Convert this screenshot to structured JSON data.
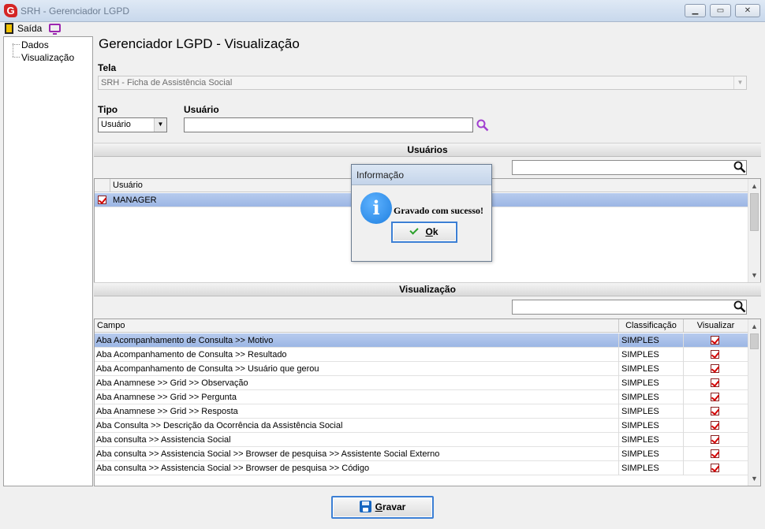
{
  "window": {
    "logo_letter": "G",
    "title": "SRH - Gerenciador LGPD",
    "min_glyph": "▁",
    "max_glyph": "▭",
    "close_glyph": "✕"
  },
  "toolbar": {
    "exit_label": "Saída"
  },
  "tree": {
    "items": [
      "Dados",
      "Visualização"
    ]
  },
  "page_title": "Gerenciador LGPD - Visualização",
  "form": {
    "tela_label": "Tela",
    "tela_value": "SRH - Ficha de Assistência Social",
    "tipo_label": "Tipo",
    "tipo_value": "Usuário",
    "usuario_label": "Usuário",
    "usuario_value": "",
    "dropdown_glyph": "▼"
  },
  "usuarios_section": {
    "title": "Usuários",
    "filter_value": "",
    "column_header": "Usuário",
    "rows": [
      {
        "name": "MANAGER",
        "checked": true,
        "selected": true
      }
    ]
  },
  "visualizacao_section": {
    "title": "Visualização",
    "filter_value": "",
    "headers": {
      "campo": "Campo",
      "classificacao": "Classificação",
      "visualizar": "Visualizar"
    },
    "rows": [
      {
        "campo": "Aba Acompanhamento de Consulta >> Motivo",
        "classificacao": "SIMPLES",
        "visualizar": true
      },
      {
        "campo": "Aba Acompanhamento de Consulta >> Resultado",
        "classificacao": "SIMPLES",
        "visualizar": true
      },
      {
        "campo": "Aba Acompanhamento de Consulta >> Usuário que gerou",
        "classificacao": "SIMPLES",
        "visualizar": true
      },
      {
        "campo": "Aba Anamnese >> Grid >> Observação",
        "classificacao": "SIMPLES",
        "visualizar": true
      },
      {
        "campo": "Aba Anamnese >> Grid >> Pergunta",
        "classificacao": "SIMPLES",
        "visualizar": true
      },
      {
        "campo": "Aba Anamnese >> Grid >> Resposta",
        "classificacao": "SIMPLES",
        "visualizar": true
      },
      {
        "campo": "Aba Consulta >>  Descrição da Ocorrência da Assistência Social",
        "classificacao": "SIMPLES",
        "visualizar": true
      },
      {
        "campo": "Aba consulta >> Assistencia Social",
        "classificacao": "SIMPLES",
        "visualizar": true
      },
      {
        "campo": "Aba consulta >> Assistencia Social >> Browser de pesquisa >> Assistente Social Externo",
        "classificacao": "SIMPLES",
        "visualizar": true
      },
      {
        "campo": "Aba consulta >> Assistencia Social >> Browser de pesquisa >> Código",
        "classificacao": "SIMPLES",
        "visualizar": true
      }
    ]
  },
  "save_button": {
    "underlined": "G",
    "rest": "ravar"
  },
  "dialog": {
    "title": "Informação",
    "icon_glyph": "i",
    "message": "Gravado com sucesso!",
    "ok_underlined": "O",
    "ok_rest": "k"
  },
  "scroll_glyphs": {
    "up": "▲",
    "down": "▼"
  },
  "colors": {
    "selection": "#9cb6e4",
    "check_mark": "#d40000",
    "focus_border": "#3c7fd4",
    "search_lens_purple": "#a13fd0"
  }
}
